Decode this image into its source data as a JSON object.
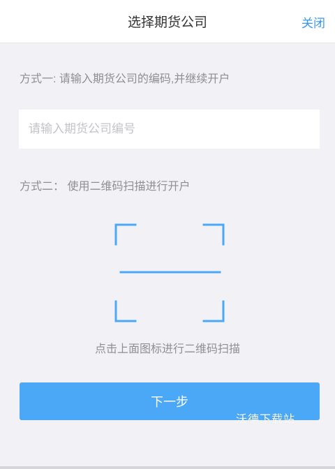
{
  "header": {
    "title": "选择期货公司",
    "close_label": "关闭"
  },
  "method1": {
    "label": "方式一: 请输入期货公司的编码,并继续开户",
    "input_placeholder": "请输入期货公司编号",
    "input_value": ""
  },
  "method2": {
    "label": "方式二： 使用二维码扫描进行开户",
    "scan_icon": "qr-scan-frame-icon",
    "scan_hint": "点击上面图标进行二维码扫描"
  },
  "next_button": {
    "label": "下一步"
  },
  "watermark": {
    "text": "沃德下载站"
  },
  "colors": {
    "accent": "#4ba8f7",
    "link": "#3a97e8",
    "background": "#f2f2f6",
    "muted_text": "#8e8e93"
  }
}
